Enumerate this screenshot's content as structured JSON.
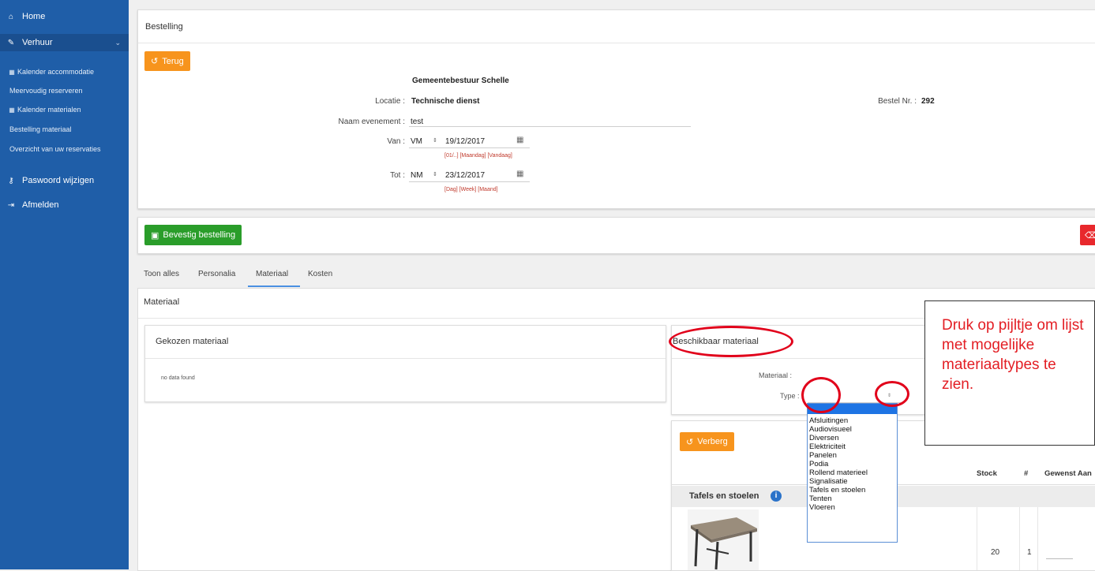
{
  "sidebar": {
    "items": [
      {
        "label": "Home",
        "icon": "home-icon",
        "glyph": "⌂"
      },
      {
        "label": "Verhuur",
        "icon": "edit-icon",
        "glyph": "✎"
      },
      {
        "label": "Kalender accommodatie",
        "icon": "calendar-icon",
        "glyph": "▦"
      },
      {
        "label": "Meervoudig reserveren"
      },
      {
        "label": "Kalender materialen",
        "icon": "calendar-icon",
        "glyph": "▦"
      },
      {
        "label": "Bestelling materiaal"
      },
      {
        "label": "Overzicht van uw reservaties"
      },
      {
        "label": "Paswoord wijzigen",
        "icon": "key-icon",
        "glyph": "⚷"
      },
      {
        "label": "Afmelden",
        "icon": "logout-icon",
        "glyph": "⇥"
      }
    ]
  },
  "order": {
    "panel_title": "Bestelling",
    "back_button": "Terug",
    "organisation": "Gemeentebestuur Schelle",
    "location_label": "Locatie :",
    "location_value": "Technische dienst",
    "order_nr_label": "Bestel Nr. :",
    "order_nr_value": "292",
    "event_label": "Naam evenement :",
    "event_value": "test",
    "from_label": "Van :",
    "from_part": "VM",
    "from_date": "19/12/2017",
    "from_shortcuts": "[01/..] [Maandag] [Vandaag]",
    "to_label": "Tot :",
    "to_part": "NM",
    "to_date": "23/12/2017",
    "to_shortcuts": "[Dag] [Week] [Maand]"
  },
  "actions": {
    "confirm_button": "Bevestig bestelling"
  },
  "tabs": [
    "Toon alles",
    "Personalia",
    "Materiaal",
    "Kosten"
  ],
  "active_tab": "Materiaal",
  "material": {
    "section_title": "Materiaal",
    "chosen_title": "Gekozen materiaal",
    "chosen_empty": "no data found",
    "available_title": "Beschikbaar materiaal",
    "material_label": "Materiaal :",
    "type_label": "Type :",
    "hide_button": "Verberg",
    "col_stock": "Stock",
    "col_hash": "#",
    "col_wanted": "Gewenst Aan",
    "category": "Tafels en stoelen",
    "row_stock": "20",
    "row_count": "1"
  },
  "type_options": [
    "Afsluitingen",
    "Audiovisueel",
    "Diversen",
    "Elektriciteit",
    "Panelen",
    "Podia",
    "Rollend materieel",
    "Signalisatie",
    "Tafels en stoelen",
    "Tenten",
    "Vloeren"
  ],
  "callout": {
    "text": "Druk op pijltje om lijst met mogelijke materiaaltypes te zien."
  },
  "colors": {
    "sidebar": "#1f5ea8",
    "orange": "#f7941d",
    "green": "#2a9d2a",
    "annotation_red": "#e1001a"
  }
}
